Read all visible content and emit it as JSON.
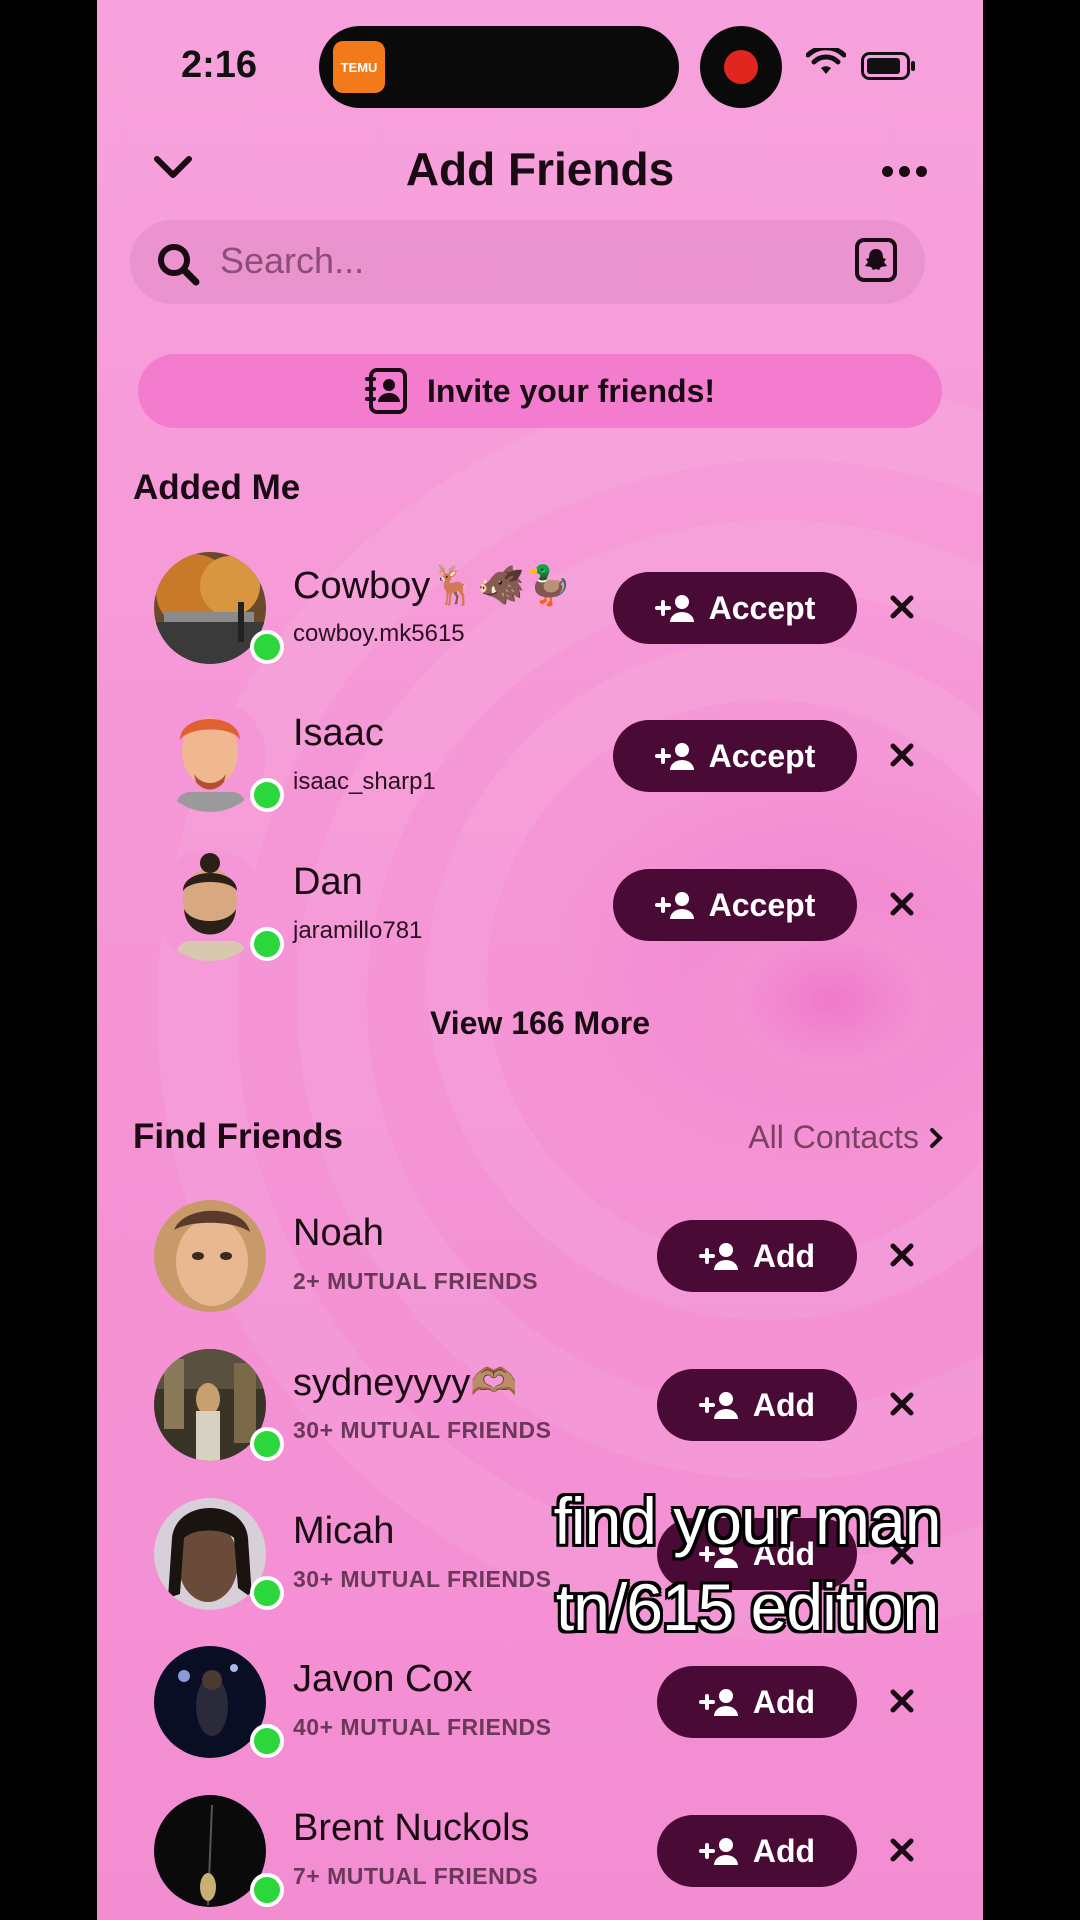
{
  "status_bar": {
    "time": "2:16",
    "app_badge": "TEMU"
  },
  "header": {
    "title": "Add Friends"
  },
  "search": {
    "placeholder": "Search..."
  },
  "invite": {
    "label": "Invite your friends!"
  },
  "added_me": {
    "title": "Added Me",
    "accept_label": "Accept",
    "items": [
      {
        "name": "Cowboy🦌🐗🦆",
        "username": "cowboy.mk5615",
        "online": true
      },
      {
        "name": "Isaac",
        "username": "isaac_sharp1",
        "online": true
      },
      {
        "name": "Dan",
        "username": "jaramillo781",
        "online": true
      }
    ],
    "view_more": "View 166 More"
  },
  "find_friends": {
    "title": "Find Friends",
    "all_contacts": "All Contacts",
    "add_label": "Add",
    "items": [
      {
        "name": "Noah",
        "mutual": "2+ MUTUAL FRIENDS",
        "online": false
      },
      {
        "name": "sydneyyyy🫶🏽",
        "mutual": "30+ MUTUAL FRIENDS",
        "online": true
      },
      {
        "name": "Micah",
        "mutual": "30+ MUTUAL FRIENDS",
        "online": true
      },
      {
        "name": "Javon Cox",
        "mutual": "40+ MUTUAL FRIENDS",
        "online": true
      },
      {
        "name": "Brent Nuckols",
        "mutual": "7+ MUTUAL FRIENDS",
        "online": true
      }
    ]
  },
  "caption": {
    "line1": "find your man",
    "line2": "tn/615 edition"
  },
  "colors": {
    "background": "#f596d6",
    "button": "#4a0a36",
    "online": "#2bd73b",
    "invite": "#f47ccf"
  }
}
